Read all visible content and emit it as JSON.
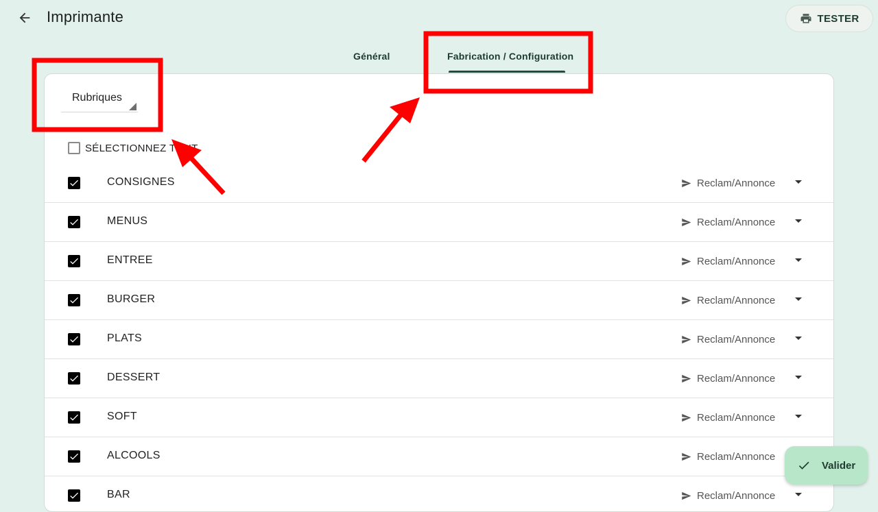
{
  "header": {
    "title": "Imprimante",
    "tester_label": "TESTER"
  },
  "tabs": [
    {
      "label": "Général",
      "active": false
    },
    {
      "label": "Fabrication / Configuration",
      "active": true
    }
  ],
  "filter": {
    "selected": "Rubriques"
  },
  "select_all": {
    "label": "SÉLECTIONNEZ TOUT",
    "checked": false
  },
  "rows": [
    {
      "name": "CONSIGNES",
      "checked": true,
      "printer": "Reclam/Annonce"
    },
    {
      "name": "MENUS",
      "checked": true,
      "printer": "Reclam/Annonce"
    },
    {
      "name": "ENTREE",
      "checked": true,
      "printer": "Reclam/Annonce"
    },
    {
      "name": "BURGER",
      "checked": true,
      "printer": "Reclam/Annonce"
    },
    {
      "name": "PLATS",
      "checked": true,
      "printer": "Reclam/Annonce"
    },
    {
      "name": "DESSERT",
      "checked": true,
      "printer": "Reclam/Annonce"
    },
    {
      "name": "SOFT",
      "checked": true,
      "printer": "Reclam/Annonce"
    },
    {
      "name": "ALCOOLS",
      "checked": true,
      "printer": "Reclam/Annonce"
    },
    {
      "name": "BAR",
      "checked": true,
      "printer": "Reclam/Annonce"
    }
  ],
  "fab": {
    "valider_label": "Valider"
  },
  "icons": {
    "back": "arrow-back-icon",
    "print": "printer-icon",
    "send": "send-icon",
    "check": "check-icon",
    "dropdown": "caret-down-icon"
  },
  "colors": {
    "background": "#e3f1ec",
    "accent": "#1f4e3b",
    "fab": "#b8e6c8",
    "annotation": "#ff0000"
  }
}
